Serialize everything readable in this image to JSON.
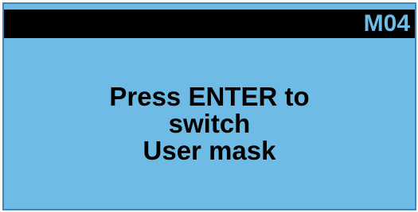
{
  "screen": {
    "code": "M04",
    "message_lines": [
      "Press ENTER to",
      "switch",
      "User mask"
    ]
  },
  "colors": {
    "background": "#6ebbe6",
    "header_bar": "#000000",
    "text": "#000000"
  }
}
